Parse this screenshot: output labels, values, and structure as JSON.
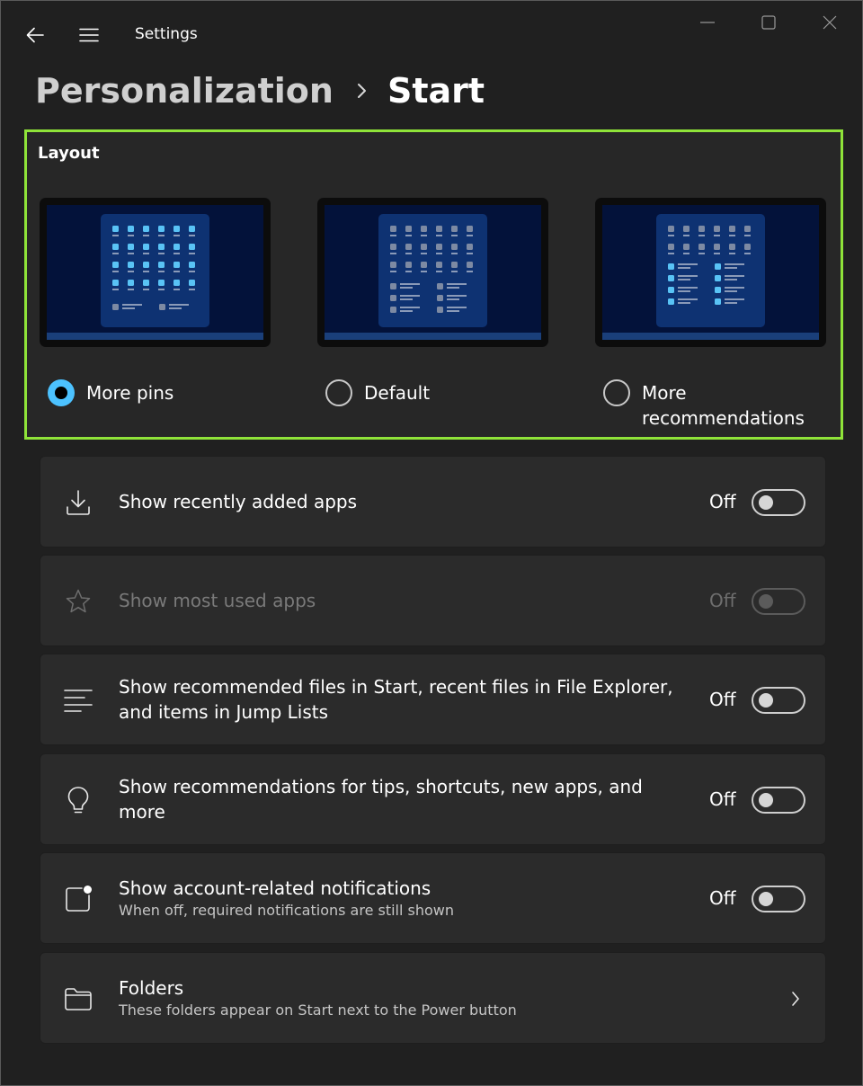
{
  "window": {
    "title": "Settings",
    "icons": {
      "back": "back-arrow-icon",
      "menu": "hamburger-menu-icon",
      "minimize": "minimize-icon",
      "maximize": "maximize-icon",
      "close": "close-icon"
    }
  },
  "breadcrumb": {
    "parent": "Personalization",
    "separator_icon": "chevron-right-icon",
    "current": "Start"
  },
  "layout": {
    "title": "Layout",
    "options": [
      {
        "label": "More pins",
        "selected": true
      },
      {
        "label": "Default",
        "selected": false
      },
      {
        "label": "More\nrecommendations",
        "label_line1": "More",
        "label_line2": "recommendations",
        "selected": false
      }
    ],
    "accent_color": "#4cc2ff",
    "highlight_border_color": "#8fe339"
  },
  "settings": [
    {
      "icon": "download-icon",
      "title": "Show recently added apps",
      "state": "Off",
      "enabled": true
    },
    {
      "icon": "star-icon",
      "title": "Show most used apps",
      "state": "Off",
      "enabled": false
    },
    {
      "icon": "list-icon",
      "title": "Show recommended files in Start, recent files in File Explorer, and items in Jump Lists",
      "state": "Off",
      "enabled": true
    },
    {
      "icon": "lightbulb-icon",
      "title": "Show recommendations for tips, shortcuts, new apps, and more",
      "state": "Off",
      "enabled": true
    },
    {
      "icon": "notification-badge-icon",
      "title": "Show account-related notifications",
      "subtitle": "When off, required notifications are still shown",
      "state": "Off",
      "enabled": true
    }
  ],
  "folders": {
    "icon": "folder-icon",
    "title": "Folders",
    "subtitle": "These folders appear on Start next to the Power button",
    "chevron_icon": "chevron-right-icon"
  }
}
